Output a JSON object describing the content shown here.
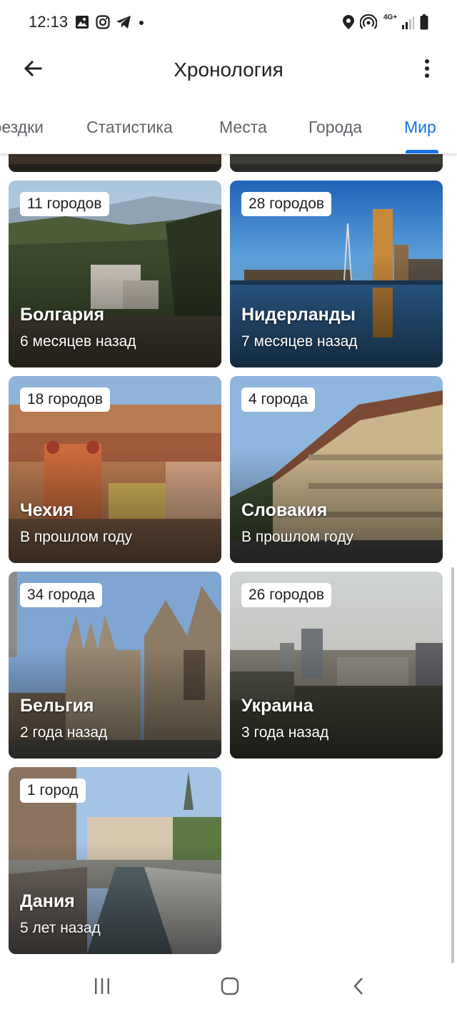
{
  "status_bar": {
    "time": "12:13",
    "network_label": "4G+",
    "icons": [
      "gallery-icon",
      "instagram-icon",
      "telegram-icon",
      "location-icon",
      "hotspot-icon",
      "signal-icon",
      "battery-icon"
    ]
  },
  "app_bar": {
    "title": "Хронология",
    "back_icon": "arrow-back-icon",
    "menu_icon": "more-vert-icon"
  },
  "tabs": [
    {
      "label": "Поездки",
      "active": false
    },
    {
      "label": "Статистика",
      "active": false
    },
    {
      "label": "Места",
      "active": false
    },
    {
      "label": "Города",
      "active": false
    },
    {
      "label": "Мир",
      "active": true
    }
  ],
  "colors": {
    "accent": "#1a73e8",
    "text_primary": "#202124",
    "text_secondary": "#5f6368"
  },
  "countries": [
    {
      "name": "Болгария",
      "cities": "11 городов",
      "ago": "6 месяцев назад"
    },
    {
      "name": "Нидерланды",
      "cities": "28 городов",
      "ago": "7 месяцев назад"
    },
    {
      "name": "Чехия",
      "cities": "18 городов",
      "ago": "В прошлом году"
    },
    {
      "name": "Словакия",
      "cities": "4 города",
      "ago": "В прошлом году"
    },
    {
      "name": "Бельгия",
      "cities": "34 города",
      "ago": "2 года назад"
    },
    {
      "name": "Украина",
      "cities": "26 городов",
      "ago": "3 года назад"
    },
    {
      "name": "Дания",
      "cities": "1 город",
      "ago": "5 лет назад"
    }
  ],
  "nav_bar": {
    "icons": [
      "recent-apps-icon",
      "home-icon",
      "back-icon"
    ]
  }
}
